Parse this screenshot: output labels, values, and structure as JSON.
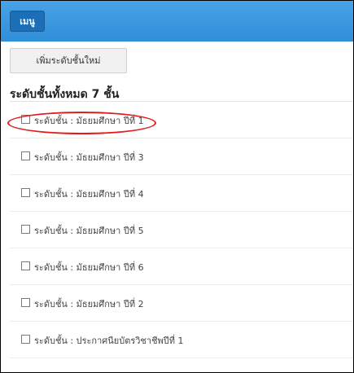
{
  "header": {
    "menu_label": "เมนู",
    "accent_color": "#3a98de"
  },
  "toolbar": {
    "add_level_label": "เพิ่มระดับชั้นใหม่"
  },
  "main": {
    "heading": "ระดับชั้นทั้งหมด 7 ชั้น",
    "items": [
      {
        "label": "ระดับชั้น : มัธยมศึกษา ปีที่ 1",
        "checked": false,
        "highlighted": true
      },
      {
        "label": "ระดับชั้น : มัธยมศึกษา ปีที่ 3",
        "checked": false
      },
      {
        "label": "ระดับชั้น : มัธยมศึกษา ปีที่ 4",
        "checked": false
      },
      {
        "label": "ระดับชั้น : มัธยมศึกษา ปีที่ 5",
        "checked": false
      },
      {
        "label": "ระดับชั้น : มัธยมศึกษา ปีที่ 6",
        "checked": false
      },
      {
        "label": "ระดับชั้น : มัธยมศึกษา ปีที่ 2",
        "checked": false
      },
      {
        "label": "ระดับชั้น : ประกาศนียบัตรวิชาชีพปีที่ 1",
        "checked": false
      }
    ]
  }
}
